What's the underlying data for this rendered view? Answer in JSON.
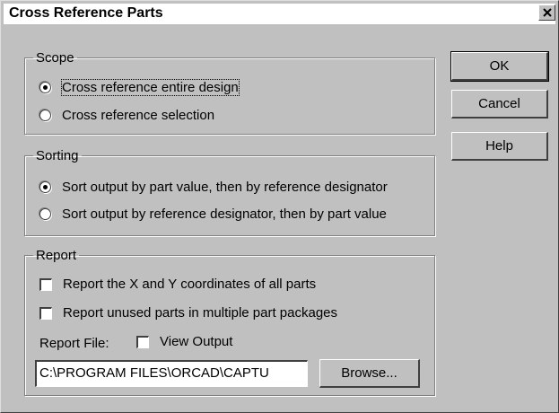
{
  "dialog": {
    "title": "Cross Reference Parts"
  },
  "scope": {
    "legend": "Scope",
    "options": [
      {
        "label": "Cross reference entire design",
        "selected": true
      },
      {
        "label": "Cross reference selection",
        "selected": false
      }
    ]
  },
  "sorting": {
    "legend": "Sorting",
    "options": [
      {
        "label": "Sort output by part value, then by reference designator",
        "selected": true
      },
      {
        "label": "Sort output by reference designator, then by part value",
        "selected": false
      }
    ]
  },
  "report": {
    "legend": "Report",
    "checkboxes": [
      {
        "label": "Report the X and Y coordinates of all parts",
        "checked": false
      },
      {
        "label": "Report unused parts in multiple part packages",
        "checked": false
      }
    ],
    "file_label": "Report File:",
    "view_output_label": "View Output",
    "view_output_checked": false,
    "file_value": "C:\\PROGRAM FILES\\ORCAD\\CAPTU",
    "browse_label": "Browse..."
  },
  "buttons": {
    "ok": "OK",
    "cancel": "Cancel",
    "help": "Help"
  }
}
